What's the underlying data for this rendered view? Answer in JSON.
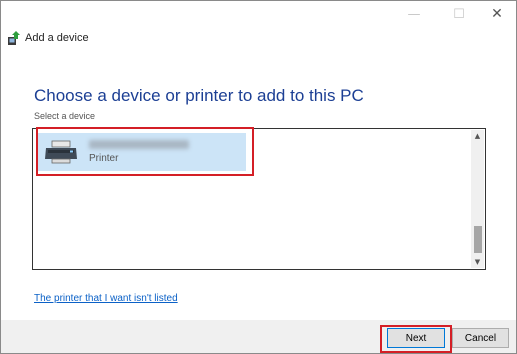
{
  "window": {
    "controls": {
      "minimize_icon": "minimize-icon",
      "maximize_icon": "maximize-icon",
      "close_icon": "close-icon"
    }
  },
  "header": {
    "title": "Add a device",
    "icon": "add-device-icon"
  },
  "main": {
    "title": "Choose a device or printer to add to this PC",
    "subtitle": "Select a device",
    "devices": [
      {
        "name_blurred": true,
        "type": "Printer",
        "icon": "printer-icon",
        "selected": true,
        "highlighted": true
      }
    ],
    "link": "The printer that I want isn't listed"
  },
  "footer": {
    "next_label": "Next",
    "cancel_label": "Cancel",
    "next_highlighted": true
  },
  "colors": {
    "title": "#1c3f94",
    "link": "#0b61c7",
    "selection": "#cce4f7",
    "highlight": "#d41f26",
    "footer_bg": "#f0f0f0"
  }
}
